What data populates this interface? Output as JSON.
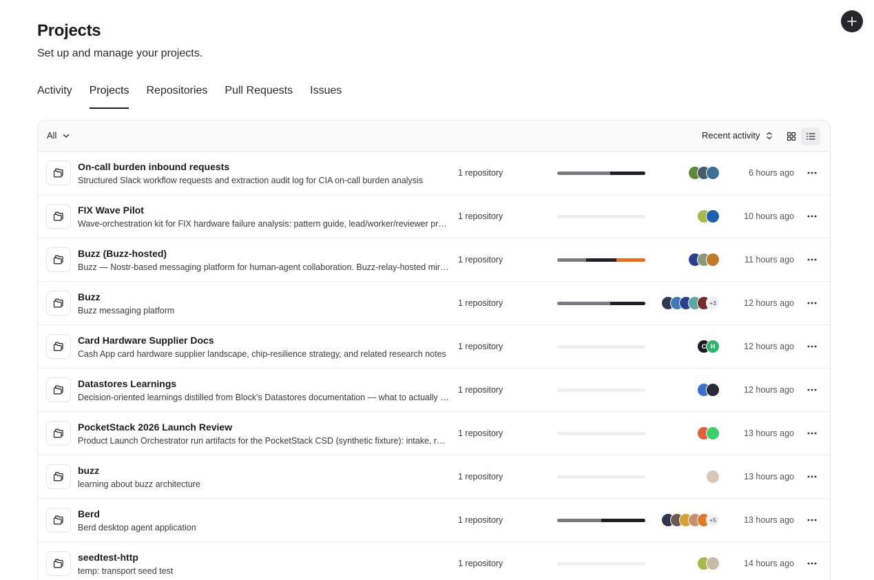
{
  "header": {
    "title": "Projects",
    "subtitle": "Set up and manage your projects.",
    "add_icon": "plus-icon"
  },
  "tabs": [
    {
      "label": "Activity",
      "active": false
    },
    {
      "label": "Projects",
      "active": true
    },
    {
      "label": "Repositories",
      "active": false
    },
    {
      "label": "Pull Requests",
      "active": false
    },
    {
      "label": "Issues",
      "active": false
    }
  ],
  "toolbar": {
    "filter_label": "All",
    "sort_label": "Recent activity",
    "views": [
      "grid-view-icon",
      "list-view-icon"
    ],
    "active_view": "list"
  },
  "colors": {
    "bar_gray": "#7a7a80",
    "bar_dark": "#1f1f25",
    "bar_orange": "#f06a1a",
    "bar_empty": "#efeff1"
  },
  "projects": [
    {
      "name": "On-call burden inbound requests",
      "description": "Structured Slack workflow requests and extraction audit log for CIA on-call burden analysis",
      "repos": "1 repository",
      "activity": [
        {
          "share": 0.6,
          "color": "#7a7a80"
        },
        {
          "share": 0.4,
          "color": "#1f1f25"
        }
      ],
      "avatars": [
        {
          "color": "#5f8a3a"
        },
        {
          "color": "#4a5a68"
        },
        {
          "color": "#3b6f9a"
        }
      ],
      "extra": "",
      "time": "6 hours ago"
    },
    {
      "name": "FIX Wave Pilot",
      "description": "Wave-orchestration kit for FIX hardware failure analysis: pattern guide, lead/worker/reviewer prompt templates, and example run artifacts",
      "repos": "1 repository",
      "activity": [],
      "avatars": [
        {
          "color": "#a8b84a"
        },
        {
          "color": "#1e5fb0"
        }
      ],
      "extra": "",
      "time": "10 hours ago"
    },
    {
      "name": "Buzz (Buzz-hosted)",
      "description": "Buzz — Nostr-based messaging platform for human-agent collaboration. Buzz-relay-hosted mirror of the project",
      "repos": "1 repository",
      "activity": [
        {
          "share": 0.33,
          "color": "#7a7a80"
        },
        {
          "share": 0.34,
          "color": "#1f1f25"
        },
        {
          "share": 0.33,
          "color": "#f06a1a"
        }
      ],
      "avatars": [
        {
          "color": "#2b3f8f"
        },
        {
          "color": "#8a9a7a"
        },
        {
          "color": "#c07a2a"
        }
      ],
      "extra": "",
      "time": "11 hours ago"
    },
    {
      "name": "Buzz",
      "description": "Buzz messaging platform",
      "repos": "1 repository",
      "activity": [
        {
          "share": 0.6,
          "color": "#7a7a80"
        },
        {
          "share": 0.4,
          "color": "#1f1f25"
        }
      ],
      "avatars": [
        {
          "color": "#2e3a55"
        },
        {
          "color": "#3a7ab8"
        },
        {
          "color": "#2b3f8f"
        },
        {
          "color": "#5aa8a0"
        },
        {
          "color": "#7a2a2a"
        }
      ],
      "extra": "+3",
      "time": "12 hours ago"
    },
    {
      "name": "Card Hardware Supplier Docs",
      "description": "Cash App card hardware supplier landscape, chip-resilience strategy, and related research notes",
      "repos": "1 repository",
      "activity": [],
      "avatars": [
        {
          "color": "#1b1b1f",
          "initial": "C"
        },
        {
          "color": "#2fb36b",
          "initial": "H"
        }
      ],
      "extra": "",
      "time": "12 hours ago"
    },
    {
      "name": "Datastores Learnings",
      "description": "Decision-oriented learnings distilled from Block's Datastores documentation — what to actually use and when",
      "repos": "1 repository",
      "activity": [],
      "avatars": [
        {
          "color": "#3a6fd0"
        },
        {
          "color": "#2a2a38"
        }
      ],
      "extra": "",
      "time": "12 hours ago"
    },
    {
      "name": "PocketStack 2026 Launch Review",
      "description": "Product Launch Orchestrator run artifacts for the PocketStack CSD (synthetic fixture): intake, review, and decision notes",
      "repos": "1 repository",
      "activity": [],
      "avatars": [
        {
          "color": "#e0603a"
        },
        {
          "color": "#3fcf6a"
        }
      ],
      "extra": "",
      "time": "13 hours ago"
    },
    {
      "name": "buzz",
      "description": "learning about buzz architecture",
      "repos": "1 repository",
      "activity": [],
      "avatars": [
        {
          "color": "#d8c8b8"
        }
      ],
      "extra": "",
      "time": "13 hours ago"
    },
    {
      "name": "Berd",
      "description": "Berd desktop agent application",
      "repos": "1 repository",
      "activity": [
        {
          "share": 0.5,
          "color": "#7a7a80"
        },
        {
          "share": 0.5,
          "color": "#1f1f25"
        }
      ],
      "avatars": [
        {
          "color": "#2e3550"
        },
        {
          "color": "#6a5a50"
        },
        {
          "color": "#d8a030"
        },
        {
          "color": "#c89070"
        },
        {
          "color": "#e07a2a"
        }
      ],
      "extra": "+5",
      "time": "13 hours ago"
    },
    {
      "name": "seedtest-http",
      "description": "temp: transport seed test",
      "repos": "1 repository",
      "activity": [],
      "avatars": [
        {
          "color": "#a8b84a"
        },
        {
          "color": "#c8bca8"
        }
      ],
      "extra": "",
      "time": "14 hours ago"
    }
  ]
}
